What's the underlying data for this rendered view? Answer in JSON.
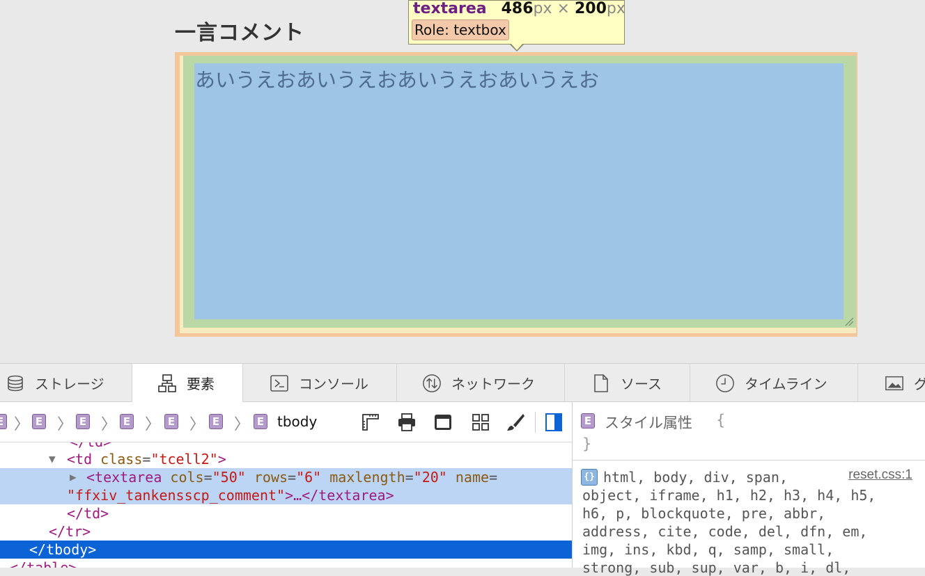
{
  "page": {
    "heading": "一言コメント",
    "textarea_value": "あいうえおあいうえおあいうえおあいうえお"
  },
  "tooltip": {
    "tag": "textarea",
    "width": "486",
    "height": "200",
    "unit": "px",
    "times": "×",
    "role": "Role: textbox"
  },
  "tabs": [
    {
      "label": "ストレージ",
      "icon": "database-icon"
    },
    {
      "label": "要素",
      "icon": "elements-icon",
      "active": true
    },
    {
      "label": "コンソール",
      "icon": "console-icon"
    },
    {
      "label": "ネットワーク",
      "icon": "network-icon"
    },
    {
      "label": "ソース",
      "icon": "document-icon"
    },
    {
      "label": "タイムライン",
      "icon": "clock-icon"
    },
    {
      "label": "グ",
      "icon": "image-icon"
    }
  ],
  "breadcrumb": {
    "badge": "E",
    "current": "tbody"
  },
  "dom": {
    "line0": "</td>",
    "line1_tag_open": "<td",
    "line1_attr": "class",
    "line1_val": "\"tcell2\"",
    "line1_tag_close": ">",
    "line2_tag_open": "<textarea",
    "line2_a1": "cols",
    "line2_v1": "\"50\"",
    "line2_a2": "rows",
    "line2_v2": "\"6\"",
    "line2_a3": "maxlength",
    "line2_v3": "\"20\"",
    "line2_a4": "name",
    "line3_val": "\"ffxiv_tankensscp_comment\"",
    "line3_rest": ">…</textarea>",
    "line4": "</td>",
    "line5": "</tr>",
    "line6": "</tbody>",
    "line7": "</table>"
  },
  "sidebar": {
    "badge": "E",
    "style_attr_title": "スタイル属性",
    "brace_open": "{",
    "brace_close": "}",
    "rule_icon": "{}",
    "rule_source": "reset.css:1",
    "selector_lines": [
      "html, body, div, span,",
      "object, iframe, h1, h2, h3, h4, h5,",
      "h6, p, blockquote, pre, abbr,",
      "address, cite, code, del, dfn, em,",
      "img, ins, kbd, q, samp, small,",
      "strong, sub, sup, var, b, i, dl,"
    ]
  },
  "colors": {
    "margin": "#f4c79a",
    "padding": "#b9d8a6",
    "content": "#9fc5e6",
    "selection": "#0b63d5"
  }
}
